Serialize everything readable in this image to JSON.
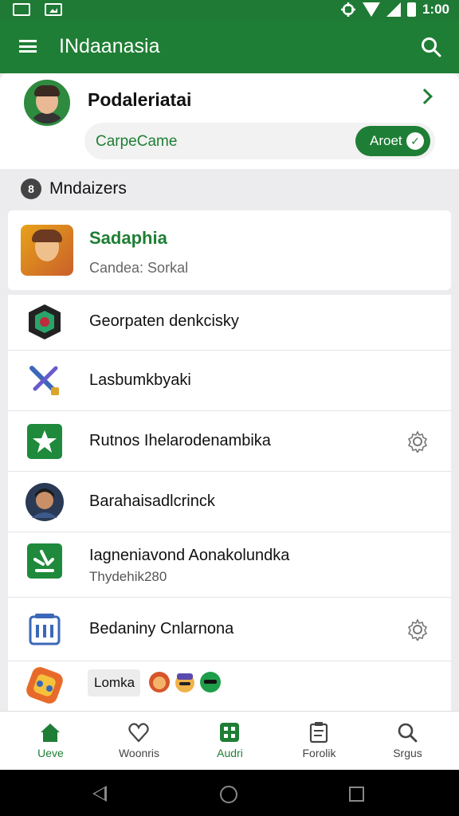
{
  "status_bar": {
    "time": "1:00"
  },
  "app_bar": {
    "title": "INdaanasia"
  },
  "profile": {
    "name": "Podaleriatai",
    "campaign_label": "CarpeCame",
    "toggle_label": "Aroet"
  },
  "section": {
    "title": "Mndaizers",
    "icon_glyph": "8"
  },
  "featured_card": {
    "title": "Sadaphia",
    "subtitle": "Candea: Sorkal"
  },
  "list_items": [
    {
      "label": "Georpaten denkcisky",
      "icon": "game-badge-icon"
    },
    {
      "label": "Lasbumkbyaki",
      "icon": "crossed-swords-icon"
    },
    {
      "label": "Rutnos Ihelarodenambika",
      "icon": "star-icon",
      "has_settings": true
    },
    {
      "label": "Barahaisadlcrinck",
      "icon": "avatar-icon"
    },
    {
      "label": "Iagneniavond Aonakolundka",
      "sublabel": "Thydehik280",
      "icon": "pin-icon"
    },
    {
      "label": "Bedaniny Cnlarnona",
      "icon": "building-icon",
      "has_settings": true
    },
    {
      "label": "Lomka",
      "icon": "puzzle-icon"
    }
  ],
  "bottom_nav": [
    {
      "label": "Ueve",
      "icon": "home-icon",
      "active": true
    },
    {
      "label": "Woonris",
      "icon": "heart-icon",
      "active": false
    },
    {
      "label": "Audri",
      "icon": "grid-icon",
      "active": true
    },
    {
      "label": "Forolik",
      "icon": "clipboard-icon",
      "active": false
    },
    {
      "label": "Srgus",
      "icon": "search-icon",
      "active": false
    }
  ],
  "colors": {
    "primary": "#1f7e35",
    "background": "#ececee"
  }
}
